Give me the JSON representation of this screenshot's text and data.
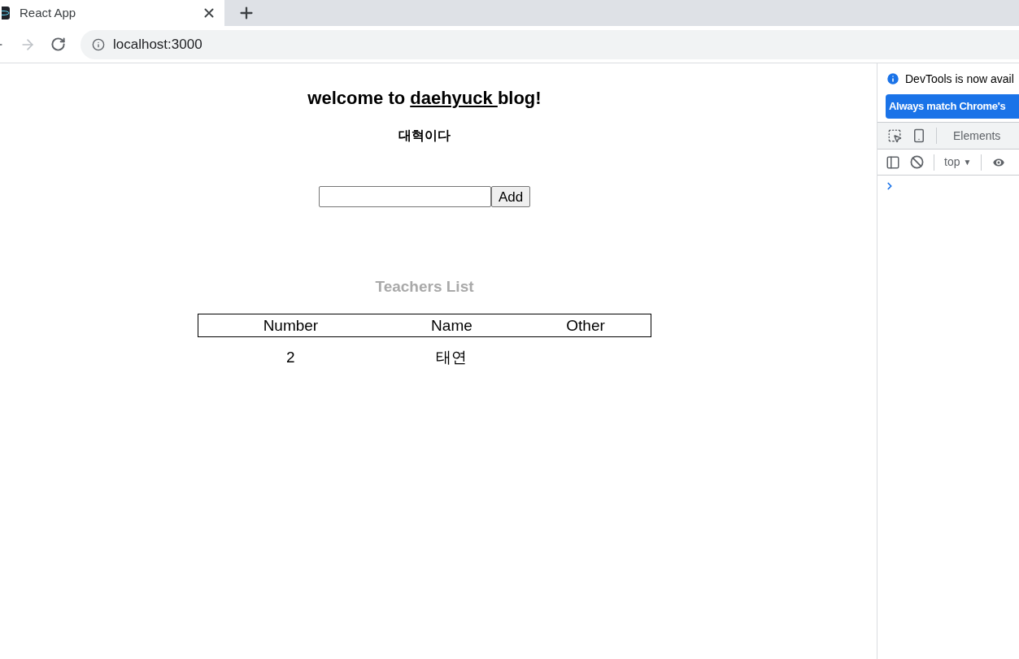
{
  "browser": {
    "tab_title": "React App",
    "address": "localhost:3000"
  },
  "page": {
    "title_before": "welcome to ",
    "title_link": "daehyuck ",
    "title_after": "blog!",
    "subtitle": "대혁이다",
    "add_button": "Add",
    "list_title": "Teachers List",
    "table": {
      "columns": [
        "Number",
        "Name",
        "Other"
      ],
      "rows": [
        [
          "2",
          "태연",
          ""
        ]
      ]
    }
  },
  "devtools": {
    "notice": "DevTools is now avail",
    "match_button": "Always match Chrome's",
    "tabs": [
      {
        "label": "Elements",
        "selected": false
      }
    ],
    "context": "top",
    "caret": "▼"
  }
}
